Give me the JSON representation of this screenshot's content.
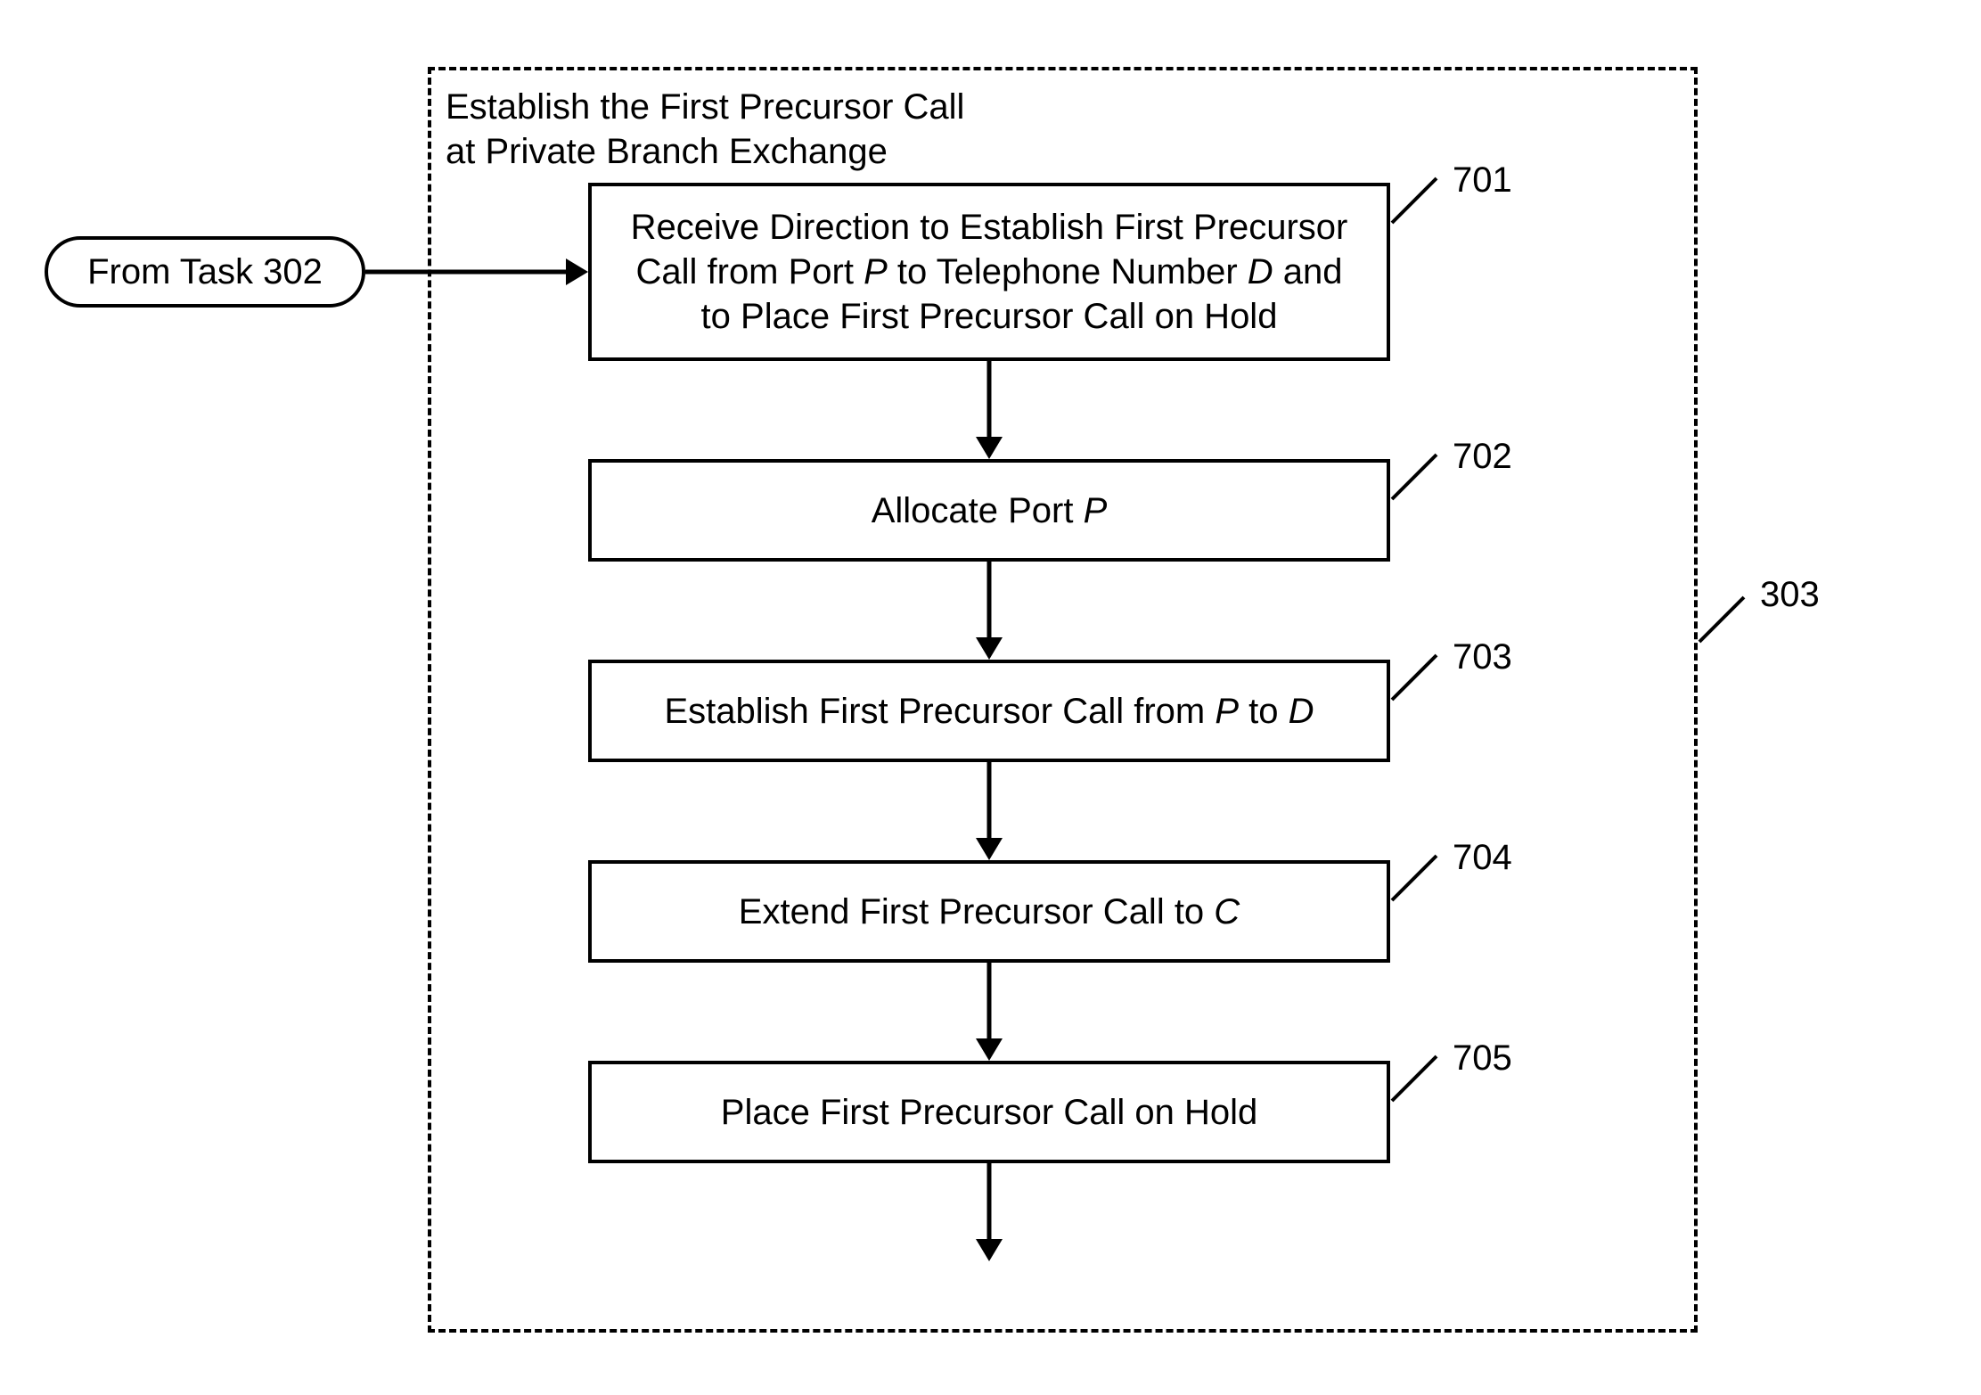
{
  "container": {
    "title_line1": "Establish the First Precursor Call",
    "title_line2": "at Private Branch Exchange",
    "ref": "303"
  },
  "entry": {
    "label": "From Task 302"
  },
  "steps": [
    {
      "ref": "701",
      "text": "Receive Direction to Establish First Precursor Call from Port <em>P</em> to Telephone Number <em>D</em> and to Place First Precursor Call on Hold"
    },
    {
      "ref": "702",
      "text": "Allocate Port <em>P</em>"
    },
    {
      "ref": "703",
      "text": "Establish First Precursor Call from <em>P</em> to <em>D</em>"
    },
    {
      "ref": "704",
      "text": "Extend First Precursor Call to <em>C</em>"
    },
    {
      "ref": "705",
      "text": "Place First Precursor Call on Hold"
    }
  ]
}
